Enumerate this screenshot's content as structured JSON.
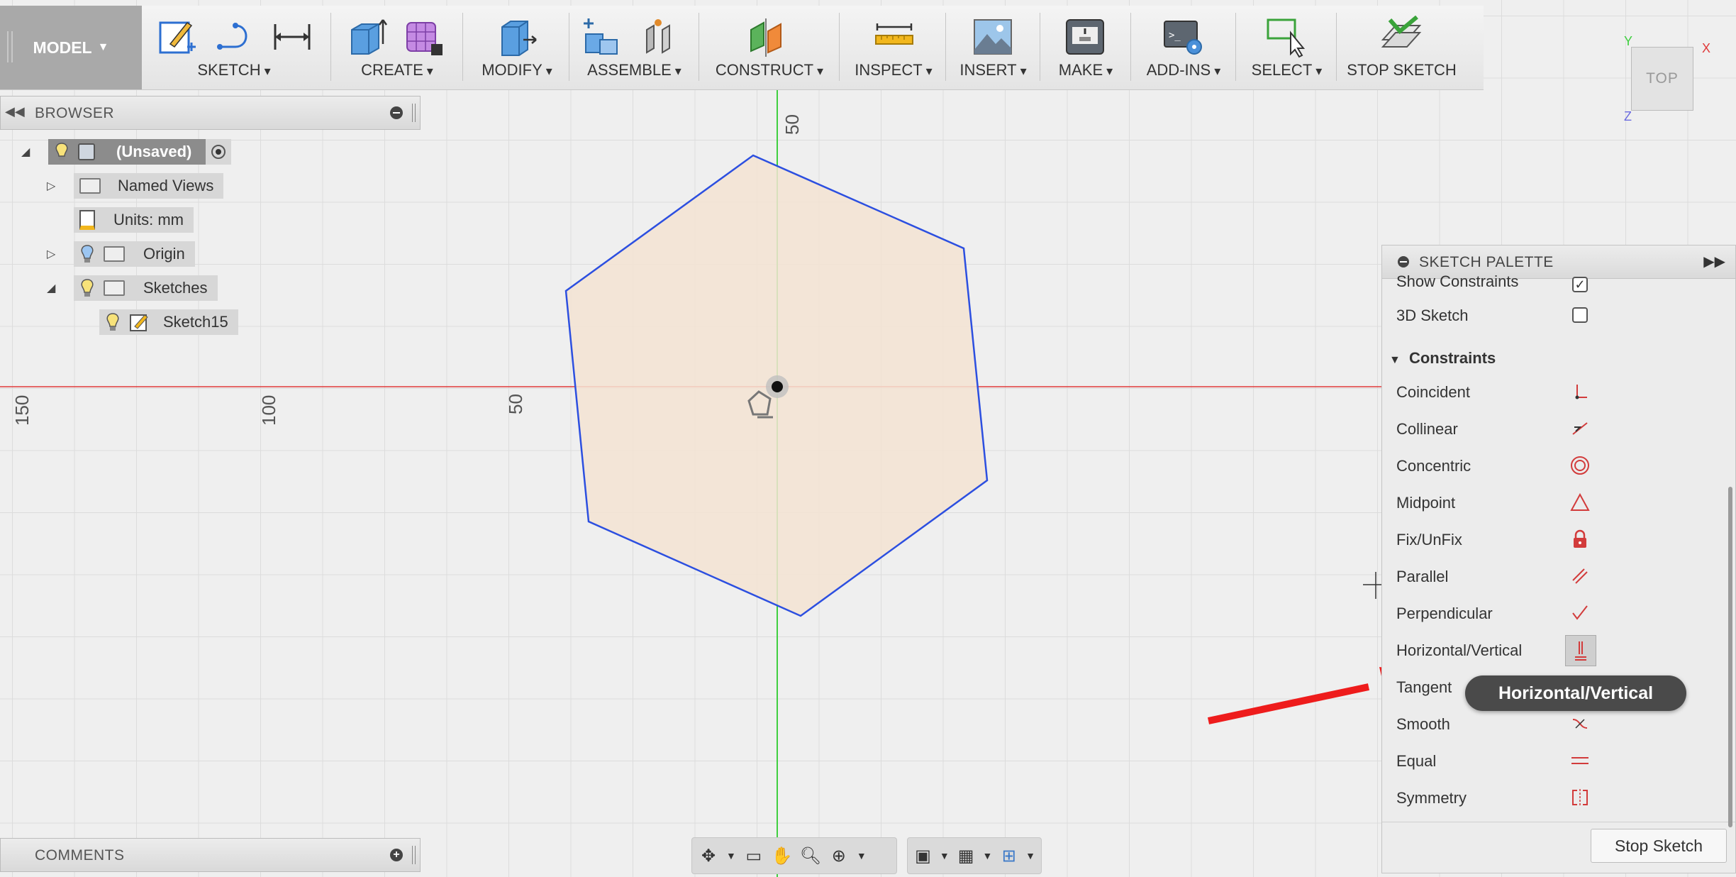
{
  "toolbar": {
    "model_label": "MODEL",
    "groups": [
      {
        "label": "SKETCH"
      },
      {
        "label": "CREATE"
      },
      {
        "label": "MODIFY"
      },
      {
        "label": "ASSEMBLE"
      },
      {
        "label": "CONSTRUCT"
      },
      {
        "label": "INSPECT"
      },
      {
        "label": "INSERT"
      },
      {
        "label": "MAKE"
      },
      {
        "label": "ADD-INS"
      },
      {
        "label": "SELECT"
      },
      {
        "label": "STOP SKETCH"
      }
    ]
  },
  "browser": {
    "title": "BROWSER",
    "items": [
      {
        "label": "(Unsaved)"
      },
      {
        "label": "Named Views"
      },
      {
        "label": "Units: mm"
      },
      {
        "label": "Origin"
      },
      {
        "label": "Sketches"
      },
      {
        "label": "Sketch15"
      }
    ]
  },
  "comments": {
    "title": "COMMENTS"
  },
  "axes": {
    "h_labels": [
      "150",
      "100",
      "50"
    ],
    "v_label": "50"
  },
  "viewcube": {
    "face": "TOP",
    "x": "X",
    "y": "Y",
    "z": "Z"
  },
  "palette": {
    "title": "SKETCH PALETTE",
    "options": [
      {
        "label": "Show Constraints",
        "checked": true
      },
      {
        "label": "3D Sketch",
        "checked": false
      }
    ],
    "section": "Constraints",
    "constraints": [
      {
        "label": "Coincident",
        "icon": "coincident-icon"
      },
      {
        "label": "Collinear",
        "icon": "collinear-icon"
      },
      {
        "label": "Concentric",
        "icon": "concentric-icon"
      },
      {
        "label": "Midpoint",
        "icon": "midpoint-icon"
      },
      {
        "label": "Fix/UnFix",
        "icon": "lock-icon"
      },
      {
        "label": "Parallel",
        "icon": "parallel-icon"
      },
      {
        "label": "Perpendicular",
        "icon": "perpendicular-icon"
      },
      {
        "label": "Horizontal/Vertical",
        "icon": "horizontal-vertical-icon"
      },
      {
        "label": "Tangent",
        "icon": "tangent-icon"
      },
      {
        "label": "Smooth",
        "icon": "smooth-icon"
      },
      {
        "label": "Equal",
        "icon": "equal-icon"
      },
      {
        "label": "Symmetry",
        "icon": "symmetry-icon"
      }
    ],
    "stop_button": "Stop Sketch"
  },
  "tooltip": "Horizontal/Vertical",
  "colors": {
    "sketch_line": "#2c4fe0",
    "profile_fill": "#f3e3d2",
    "x_axis": "#e03a3a",
    "y_axis": "#3fcf3f",
    "annotation_arrow": "#ee1c1c",
    "constraint_icon": "#d23b3b"
  }
}
